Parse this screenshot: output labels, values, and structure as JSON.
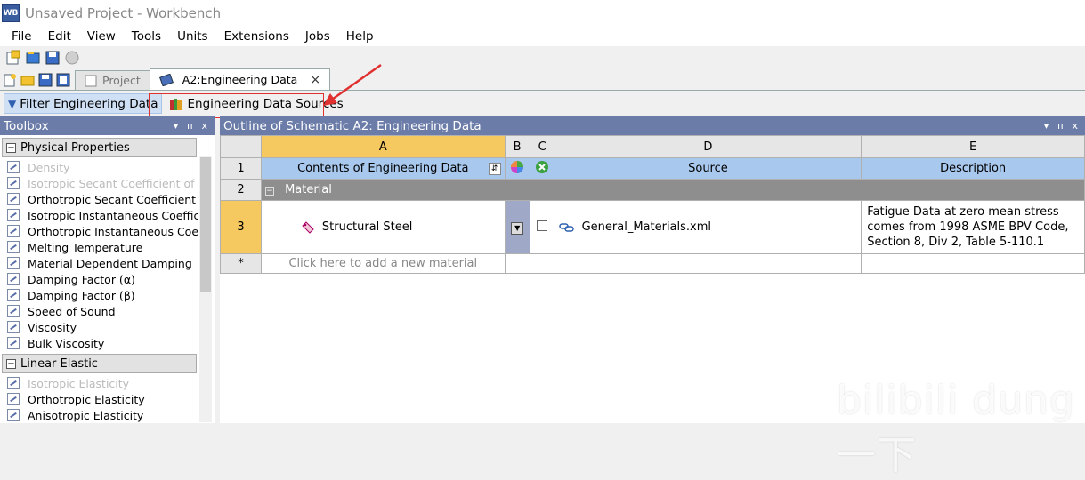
{
  "window": {
    "title": "Unsaved Project - Workbench",
    "app_icon": "WB"
  },
  "menu": [
    "File",
    "Edit",
    "View",
    "Tools",
    "Units",
    "Extensions",
    "Jobs",
    "Help"
  ],
  "tabs": [
    {
      "label": "Project",
      "active": false
    },
    {
      "label": "A2:Engineering Data",
      "active": true
    }
  ],
  "subtoolbar": {
    "filter_label": "Filter Engineering Data",
    "sources_label": "Engineering Data Sources"
  },
  "toolbox": {
    "title": "Toolbox",
    "groups": [
      {
        "label": "Physical Properties",
        "items": [
          {
            "label": "Density",
            "disabled": true
          },
          {
            "label": "Isotropic Secant Coefficient of Th",
            "disabled": true
          },
          {
            "label": "Orthotropic Secant Coefficient of",
            "disabled": false
          },
          {
            "label": "Isotropic Instantaneous Coefficie",
            "disabled": false
          },
          {
            "label": "Orthotropic Instantaneous Coeffi",
            "disabled": false
          },
          {
            "label": "Melting Temperature",
            "disabled": false
          },
          {
            "label": "Material Dependent Damping",
            "disabled": false
          },
          {
            "label": "Damping Factor (α)",
            "disabled": false
          },
          {
            "label": "Damping Factor (β)",
            "disabled": false
          },
          {
            "label": "Speed of Sound",
            "disabled": false
          },
          {
            "label": "Viscosity",
            "disabled": false
          },
          {
            "label": "Bulk Viscosity",
            "disabled": false
          }
        ]
      },
      {
        "label": "Linear Elastic",
        "items": [
          {
            "label": "Isotropic Elasticity",
            "disabled": true
          },
          {
            "label": "Orthotropic Elasticity",
            "disabled": false
          },
          {
            "label": "Anisotropic Elasticity",
            "disabled": false
          }
        ]
      }
    ]
  },
  "outline": {
    "title": "Outline of Schematic A2: Engineering Data",
    "columns": [
      "A",
      "B",
      "C",
      "D",
      "E"
    ],
    "header_row": {
      "num": "1",
      "contents": "Contents of Engineering Data",
      "source": "Source",
      "description": "Description"
    },
    "material_row": {
      "num": "2",
      "label": "Material"
    },
    "steel_row": {
      "num": "3",
      "name": "Structural Steel",
      "source": "General_Materials.xml",
      "description": "Fatigue Data at zero mean stress comes from 1998 ASME BPV Code, Section 8, Div 2, Table 5-110.1"
    },
    "new_row": {
      "num": "*",
      "placeholder": "Click here to add a new material"
    }
  },
  "panel_controls": {
    "pin": "▾",
    "autohide": "ᴨ",
    "close": "x"
  },
  "watermark": "bilibili dung一下",
  "colors": {
    "panel_header": "#6b7ca8",
    "selected_col": "#f5c860",
    "header_row": "#a8c8ee",
    "material_row": "#8e8e8e",
    "highlight_box": "#e03030"
  }
}
